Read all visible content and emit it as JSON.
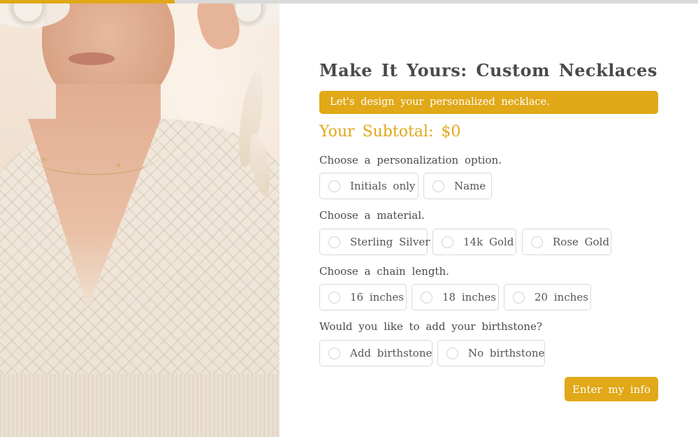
{
  "progress": {
    "fraction": 0.25,
    "color": "#e1a817",
    "track_color": "#d9d9d9"
  },
  "header": {
    "title": "Make It Yours: Custom Necklaces",
    "intro": "Let's design your personalized necklace.",
    "subtotal": "Your Subtotal: $0"
  },
  "questions": [
    {
      "label": "Choose a personalization option.",
      "options": [
        "Initials only",
        "Name"
      ]
    },
    {
      "label": "Choose a material.",
      "options": [
        "Sterling Silver",
        "14k Gold",
        "Rose Gold"
      ]
    },
    {
      "label": "Choose a chain length.",
      "options": [
        "16 inches",
        "18 inches",
        "20 inches"
      ]
    },
    {
      "label": "Would you like to add your birthstone?",
      "options": [
        "Add birthstone",
        "No birthstone"
      ]
    }
  ],
  "next_button": "Enter my info",
  "colors": {
    "accent": "#e1a817",
    "text": "#4a4a4a",
    "border": "#d9d9d9"
  },
  "photo": {
    "description_icon": "model-wearing-necklace-photo"
  }
}
